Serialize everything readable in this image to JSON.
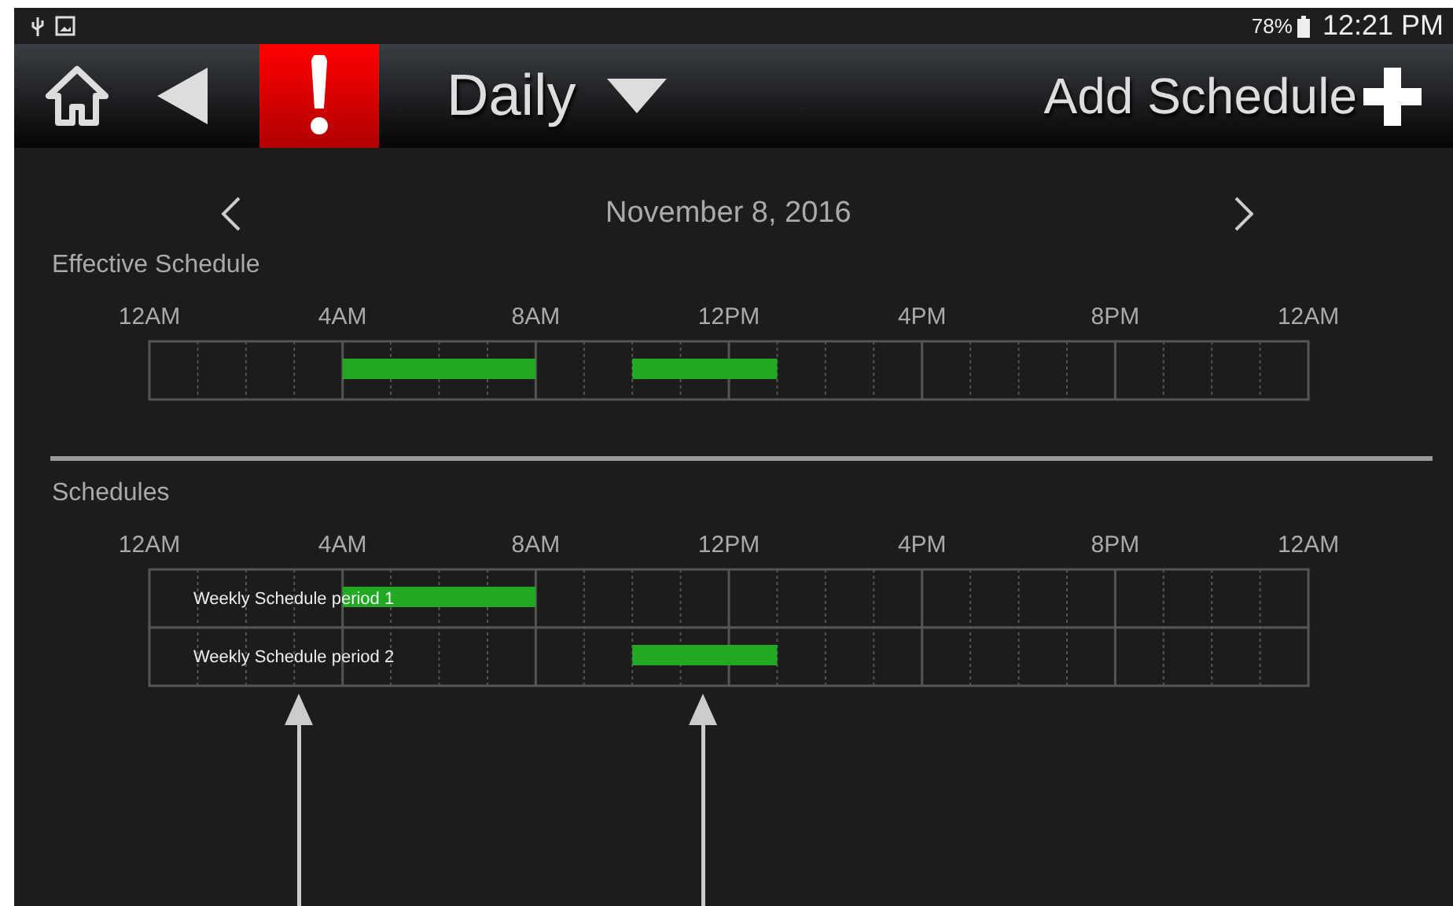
{
  "status_bar": {
    "battery": "78%",
    "time": "12:21 PM"
  },
  "toolbar": {
    "title": "Daily",
    "add_button": "Add Schedule"
  },
  "date_nav": {
    "date": "November 8, 2016"
  },
  "effective_schedule": {
    "title": "Effective Schedule",
    "time_labels": [
      "12AM",
      "4AM",
      "8AM",
      "12PM",
      "4PM",
      "8PM",
      "12AM"
    ],
    "rows": [
      {
        "hours_on": [
          false,
          false,
          false,
          false,
          true,
          true,
          true,
          true,
          false,
          false,
          true,
          true,
          true,
          false,
          false,
          false,
          false,
          false,
          false,
          false,
          false,
          false,
          false,
          false
        ]
      }
    ]
  },
  "schedules": {
    "title": "Schedules",
    "time_labels": [
      "12AM",
      "4AM",
      "8AM",
      "12PM",
      "4PM",
      "8PM",
      "12AM"
    ],
    "rows": [
      {
        "name": "Weekly Schedule period 1",
        "hours_on": [
          false,
          false,
          false,
          false,
          true,
          true,
          true,
          true,
          false,
          false,
          false,
          false,
          false,
          false,
          false,
          false,
          false,
          false,
          false,
          false,
          false,
          false,
          false,
          false
        ]
      },
      {
        "name": "Weekly Schedule period 2",
        "hours_on": [
          false,
          false,
          false,
          false,
          false,
          false,
          false,
          false,
          false,
          false,
          true,
          true,
          true,
          false,
          false,
          false,
          false,
          false,
          false,
          false,
          false,
          false,
          false,
          false
        ]
      }
    ]
  }
}
